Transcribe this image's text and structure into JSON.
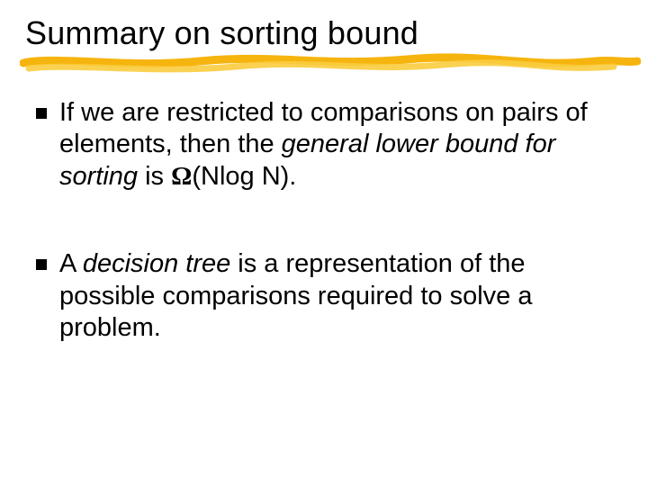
{
  "title": "Summary on sorting bound",
  "bullets": [
    {
      "pre": "If we are restricted to comparisons on pairs of elements, then the ",
      "em1": "general lower bound for sorting",
      "mid": " is ",
      "omega": "Ω",
      "post": "(Nlog N)."
    },
    {
      "pre": "A ",
      "em1": "decision tree",
      "post": " is a representation of the possible comparisons required to solve a problem."
    }
  ]
}
